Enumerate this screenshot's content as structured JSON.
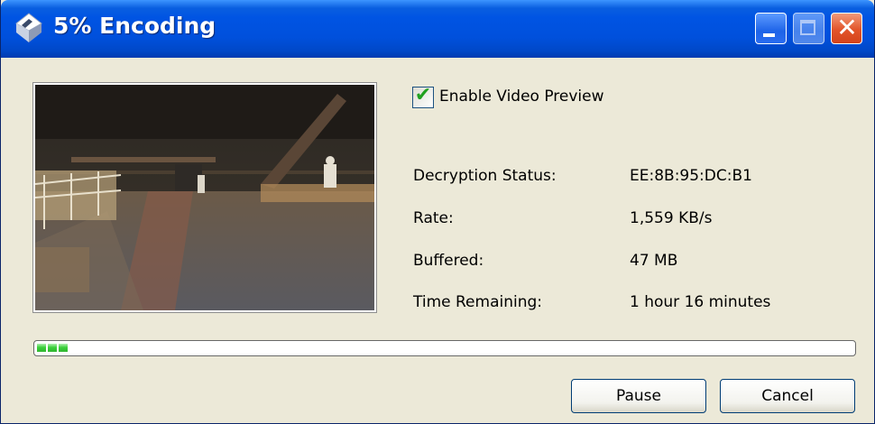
{
  "window": {
    "title": "5% Encoding"
  },
  "preview": {
    "enable_label": "Enable Video Preview",
    "enable_checked": true
  },
  "stats": [
    {
      "label": "Decryption Status:",
      "value": "EE:8B:95:DC:B1"
    },
    {
      "label": "Rate:",
      "value": "1,559 KB/s"
    },
    {
      "label": "Buffered:",
      "value": "47 MB"
    },
    {
      "label": "Time Remaining:",
      "value": "1 hour 16 minutes"
    }
  ],
  "progress": {
    "percent": 5
  },
  "buttons": {
    "pause": "Pause",
    "cancel": "Cancel"
  },
  "colors": {
    "titlebar": "#0054e3",
    "progress_fill": "#3bd13b",
    "checkmark": "#21a121",
    "close_button": "#e2542a"
  }
}
